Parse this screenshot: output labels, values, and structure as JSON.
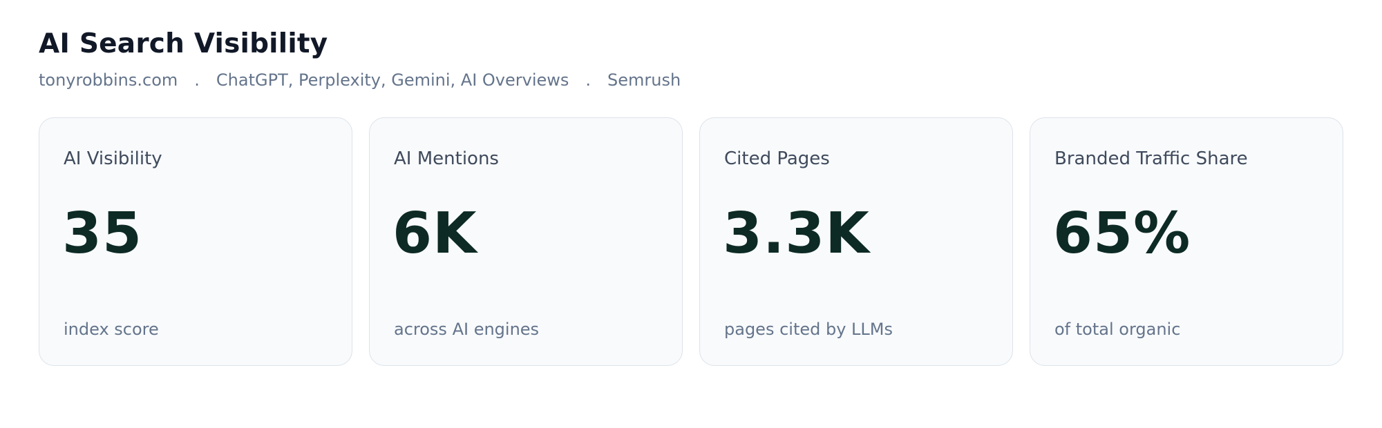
{
  "header": {
    "title": "AI Search Visibility",
    "subtitle": {
      "domain": "tonyrobbins.com",
      "engines": "ChatGPT, Perplexity, Gemini, AI Overviews",
      "source": "Semrush",
      "separator": "."
    }
  },
  "cards": [
    {
      "label": "AI Visibility",
      "value": "35",
      "note": "index score"
    },
    {
      "label": "AI Mentions",
      "value": "6K",
      "note": "across AI engines"
    },
    {
      "label": "Cited Pages",
      "value": "3.3K",
      "note": "pages cited by LLMs"
    },
    {
      "label": "Branded Traffic Share",
      "value": "65%",
      "note": "of total organic"
    }
  ],
  "colors": {
    "value_text": "#0d2a24",
    "card_background": "#f8fafc",
    "card_border": "#dde3ea",
    "muted_text": "#64748b"
  }
}
